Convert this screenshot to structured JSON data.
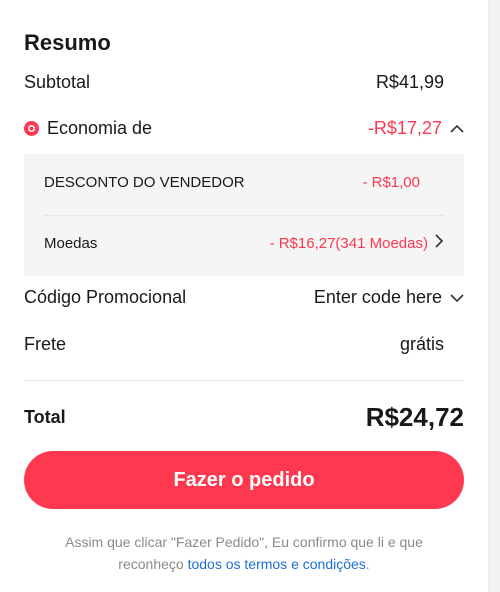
{
  "summary": {
    "title": "Resumo",
    "subtotal_label": "Subtotal",
    "subtotal_value": "R$41,99",
    "economy_label": "Economia de",
    "economy_value": "-R$17,27",
    "seller_discount_label": "DESCONTO DO VENDEDOR",
    "seller_discount_value": "- R$1,00",
    "coins_label": "Moedas",
    "coins_value": "- R$16,27(341 Moedas)",
    "promo_label": "Código Promocional",
    "promo_value": "Enter code here",
    "shipping_label": "Frete",
    "shipping_value": "grátis",
    "total_label": "Total",
    "total_value": "R$24,72"
  },
  "order_button_label": "Fazer o pedido",
  "disclaimer": {
    "line1": "Assim que clicar \"Fazer Pedido\", Eu confirmo que li e que",
    "line2_prefix": "reconheço ",
    "link_text": "todos os termos e condições",
    "line2_suffix": "."
  },
  "colors": {
    "accent": "#fd384f",
    "link": "#1a6fd6",
    "breakdown_bg": "#f5f5f5"
  },
  "icons": {
    "economy": "discount-badge-icon",
    "economy_toggle": "chevron-up-icon",
    "coins_detail": "chevron-right-icon",
    "promo_toggle": "chevron-down-icon"
  }
}
